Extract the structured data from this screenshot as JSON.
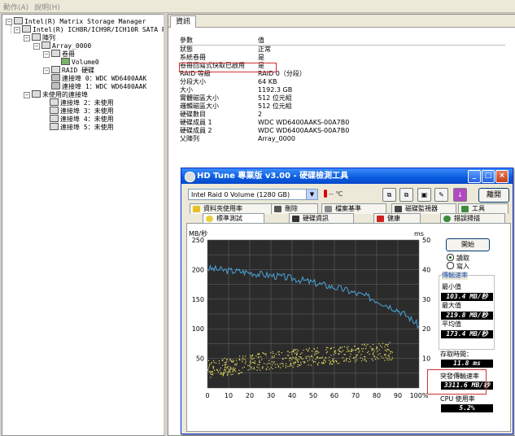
{
  "menubar": {
    "items": [
      "動作(A)",
      "說明(H)"
    ]
  },
  "tree": {
    "nodes": [
      "Intel(R) Matrix Storage Manager",
      "Intel(R) ICH8R/ICH9R/ICH10R SATA RAI",
      "陣列",
      "Array_0000",
      "卷冊",
      "Volume0",
      "RAID 硬碟",
      "連接埠 0：WDC WD6400AAK",
      "連接埠 1：WDC WD6400AAK",
      "未使用的連接埠",
      "連接埠 2：未使用",
      "連接埠 3：未使用",
      "連接埠 4：未使用",
      "連接埠 5：未使用"
    ]
  },
  "info": {
    "tab": "資訊",
    "header": {
      "key": "參數",
      "value": "值"
    },
    "rows": [
      {
        "key": "狀態",
        "value": "正常"
      },
      {
        "key": "系統卷冊",
        "value": "是"
      },
      {
        "key": "卷冊回寫式快取已啟用",
        "value": "是"
      },
      {
        "key": "RAID 等級",
        "value": "RAID 0（分段）"
      },
      {
        "key": "分段大小",
        "value": "64 KB"
      },
      {
        "key": "大小",
        "value": "1192.3 GB"
      },
      {
        "key": "實體磁區大小",
        "value": "512 位元組"
      },
      {
        "key": "邏輯磁區大小",
        "value": "512 位元組"
      },
      {
        "key": "硬碟數目",
        "value": "2"
      },
      {
        "key": "硬碟成員 1",
        "value": "WDC WD6400AAKS-00A7B0"
      },
      {
        "key": "硬碟成員 2",
        "value": "WDC WD6400AAKS-00A7B0"
      },
      {
        "key": "父陣列",
        "value": "Array_0000"
      }
    ]
  },
  "hdtune": {
    "title": "HD Tune 專業版 v3.00 - 硬碟檢測工具",
    "drive": "Intel   Raid 0 Volume  (1280 GB)",
    "temp": "-- ℃",
    "exit": "離開",
    "tabs_top": [
      "資料夾使用率",
      "刪除",
      "檔案基準",
      "磁碟監視器",
      "工具"
    ],
    "tabs_bottom": [
      "標準測試",
      "硬碟資訊",
      "健康",
      "錯誤掃描"
    ],
    "start": "開始",
    "read": "讀取",
    "write": "寫入",
    "transfer_title": "傳輸速率",
    "min_label": "最小值",
    "max_label": "最大值",
    "avg_label": "平均值",
    "min": "103.4 MB/秒",
    "max": "219.8 MB/秒",
    "avg": "173.4 MB/秒",
    "access_label": "存取時間：",
    "access": "11.8 ms",
    "burst_label": "突發傳輸速率",
    "burst": "3311.6 MB/秒",
    "cpu_label": "CPU 使用率",
    "cpu": "5.2%",
    "colors": {
      "titlebar": "#0a5ce0",
      "graph_bg": "#2b2b2b",
      "transfer_line": "#4aa3d8",
      "access_dots": "#e8e060"
    }
  },
  "chart_data": {
    "type": "line",
    "ylabel_left": "MB/秒",
    "ylabel_right": "ms",
    "x_ticks": [
      "0",
      "10",
      "20",
      "30",
      "40",
      "50",
      "60",
      "70",
      "80",
      "90",
      "100%"
    ],
    "y_left_ticks": [
      "50",
      "100",
      "150",
      "200",
      "250"
    ],
    "y_right_ticks": [
      "10",
      "20",
      "30",
      "40",
      "50"
    ],
    "ylim_left": [
      0,
      250
    ],
    "ylim_right": [
      0,
      50
    ],
    "xlim": [
      0,
      100
    ],
    "grid": true,
    "series": [
      {
        "name": "傳輸速率",
        "axis": "left",
        "x": [
          0,
          5,
          10,
          15,
          20,
          25,
          30,
          35,
          40,
          45,
          50,
          55,
          60,
          65,
          70,
          75,
          80,
          85,
          90,
          95,
          100
        ],
        "values": [
          202,
          200,
          198,
          197,
          195,
          192,
          190,
          188,
          185,
          182,
          178,
          174,
          170,
          166,
          160,
          155,
          148,
          140,
          132,
          120,
          105
        ]
      },
      {
        "name": "存取時間",
        "axis": "right",
        "x": [
          0,
          10,
          20,
          30,
          40,
          50,
          60,
          70,
          80,
          90,
          100
        ],
        "values": [
          6.5,
          7.5,
          8.5,
          9.5,
          10.2,
          10.8,
          11.3,
          11.8,
          12.3,
          12.8,
          13.3
        ]
      }
    ]
  }
}
